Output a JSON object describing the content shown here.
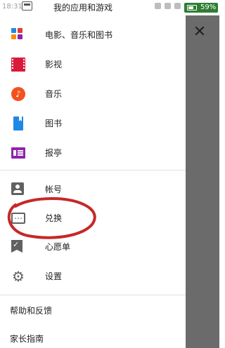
{
  "status_bar": {
    "time": "18:31",
    "title": "我的应用和游戏",
    "battery": "59%"
  },
  "drawer": {
    "primary_items": [
      {
        "label": "电影、音乐和图书",
        "icon": "apps-icon"
      },
      {
        "label": "影视",
        "icon": "movies-icon"
      },
      {
        "label": "音乐",
        "icon": "music-icon"
      },
      {
        "label": "图书",
        "icon": "books-icon"
      },
      {
        "label": "报亭",
        "icon": "newsstand-icon"
      }
    ],
    "secondary_items": [
      {
        "label": "帐号",
        "icon": "account-icon"
      },
      {
        "label": "兑换",
        "icon": "redeem-icon"
      },
      {
        "label": "心愿单",
        "icon": "wishlist-icon"
      },
      {
        "label": "设置",
        "icon": "settings-icon"
      }
    ],
    "footer_items": [
      {
        "label": "帮助和反馈"
      },
      {
        "label": "家长指南"
      }
    ]
  },
  "colors": {
    "movies": "#d81b3c",
    "music": "#f4511e",
    "books": "#1e88e5",
    "newsstand": "#8e24aa",
    "annotation": "#c62828",
    "battery": "#2e7d32"
  }
}
